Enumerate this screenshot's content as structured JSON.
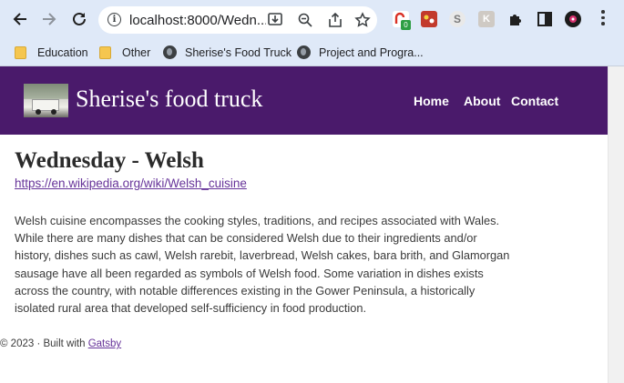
{
  "browser": {
    "url": "localhost:8000/Wedn...",
    "extension_badge": "0",
    "bookmarks": [
      {
        "label": "Education",
        "icon": "folder-icon"
      },
      {
        "label": "Other",
        "icon": "folder-icon"
      },
      {
        "label": "Sherise's Food Truck",
        "icon": "globe-icon"
      },
      {
        "label": "Project and Progra...",
        "icon": "globe-icon"
      }
    ]
  },
  "site": {
    "title": "Sherise's food truck",
    "nav": [
      "Home",
      "About",
      "Contact"
    ],
    "header_color": "#4a1a6b"
  },
  "page": {
    "heading": "Wednesday - Welsh",
    "link": "https://en.wikipedia.org/wiki/Welsh_cuisine",
    "body": "Welsh cuisine encompasses the cooking styles, traditions, and recipes associated with Wales. While there are many dishes that can be considered Welsh due to their ingredients and/or history, dishes such as cawl, Welsh rarebit, laverbread, Welsh cakes, bara brith, and Glamorgan sausage have all been regarded as symbols of Welsh food. Some variation in dishes exists across the country, with notable differences existing in the Gower Peninsula, a historically isolated rural area that developed self-sufficiency in food production."
  },
  "footer": {
    "text": "© 2023 · Built with",
    "link": "Gatsby"
  }
}
